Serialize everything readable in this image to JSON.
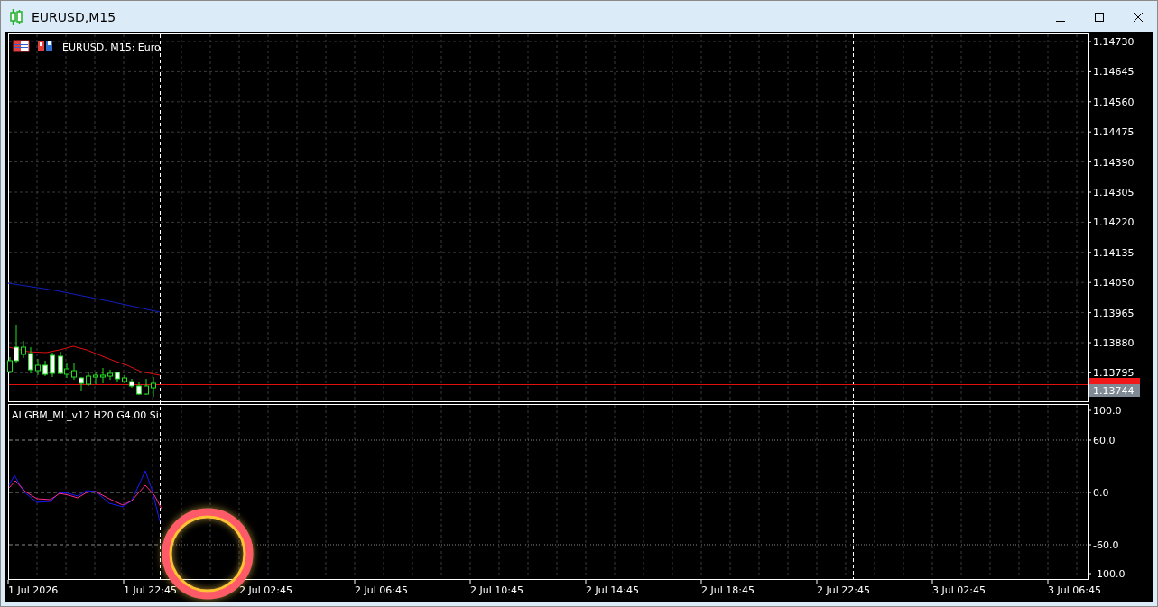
{
  "window": {
    "title": "EURUSD,M15"
  },
  "chart": {
    "label": "EURUSD, M15:  Euro",
    "price_axis": [
      "1.14730",
      "1.14645",
      "1.14560",
      "1.14475",
      "1.14390",
      "1.14305",
      "1.14220",
      "1.14135",
      "1.14050",
      "1.13965",
      "1.13880",
      "1.13795"
    ],
    "price_tags": [
      {
        "label": "1.13744",
        "color": "#808a94"
      }
    ]
  },
  "indicator": {
    "label": "AI GBM_ML_v12 H20 G4.00 Si",
    "axis": [
      "100.0",
      "60.0",
      "0.0",
      "-60.0",
      "-100.0"
    ]
  },
  "time_axis": [
    "1 Jul 2026",
    "1 Jul 22:45",
    "2 Jul 02:45",
    "2 Jul 06:45",
    "2 Jul 10:45",
    "2 Jul 14:45",
    "2 Jul 18:45",
    "2 Jul 22:45",
    "3 Jul 02:45",
    "3 Jul 06:45"
  ]
}
